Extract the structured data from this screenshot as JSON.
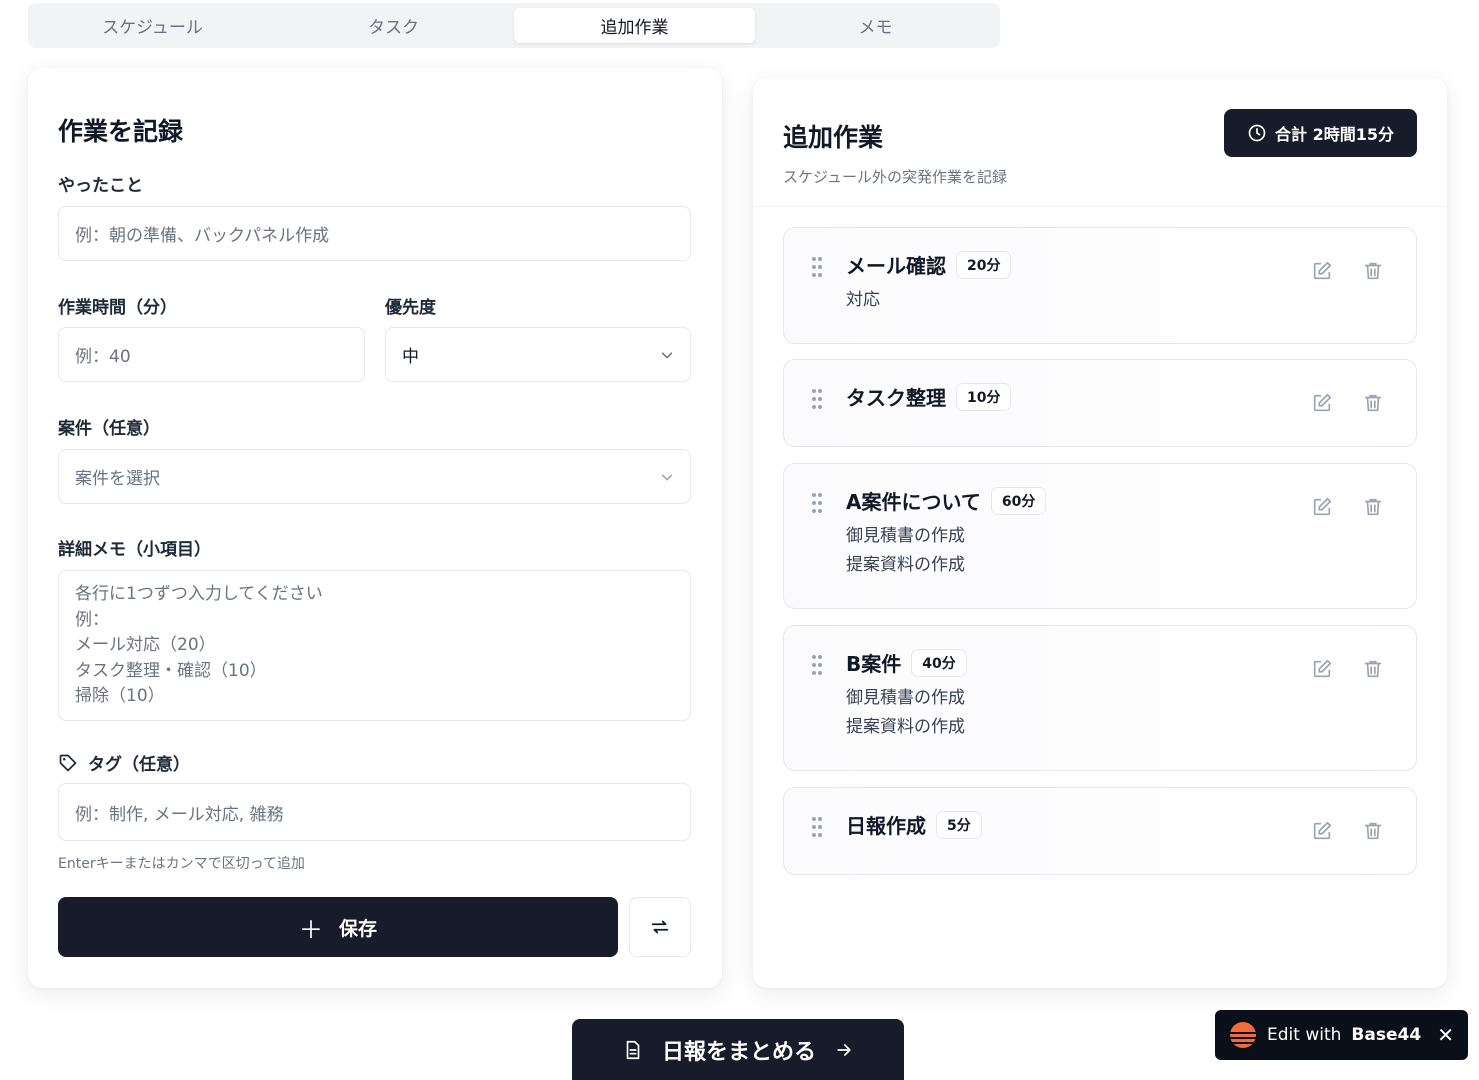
{
  "tabs": [
    {
      "label": "スケジュール"
    },
    {
      "label": "タスク"
    },
    {
      "label": "追加作業",
      "active": true
    },
    {
      "label": "メモ"
    }
  ],
  "form": {
    "title": "作業を記録",
    "what_label": "やったこと",
    "what_placeholder": "例：朝の準備、バックパネル作成",
    "time_label": "作業時間（分）",
    "time_placeholder": "例：40",
    "priority_label": "優先度",
    "priority_value": "中",
    "project_label": "案件（任意）",
    "project_placeholder": "案件を選択",
    "memo_label": "詳細メモ（小項目）",
    "memo_placeholder": "各行に1つずつ入力してください\n例：\nメール対応（20）\nタスク整理・確認（10）\n掃除（10）",
    "tag_label": "タグ（任意）",
    "tag_placeholder": "例：制作, メール対応, 雑務",
    "tag_hint": "Enterキーまたはカンマで区切って追加",
    "save_label": "保存"
  },
  "list": {
    "title": "追加作業",
    "subtitle": "スケジュール外の突発作業を記録",
    "total_label": "合計 2時間15分",
    "items": [
      {
        "title": "メール確認",
        "minutes": "20分",
        "lines": [
          "対応"
        ]
      },
      {
        "title": "タスク整理",
        "minutes": "10分",
        "lines": []
      },
      {
        "title": "A案件について",
        "minutes": "60分",
        "lines": [
          "御見積書の作成",
          "提案資料の作成"
        ]
      },
      {
        "title": "B案件",
        "minutes": "40分",
        "lines": [
          "御見積書の作成",
          "提案資料の作成"
        ]
      },
      {
        "title": "日報作成",
        "minutes": "5分",
        "lines": []
      }
    ]
  },
  "footer": {
    "summary_label": "日報をまとめる",
    "edit_with": "Edit with",
    "brand": "Base44"
  },
  "colors": {
    "primary": "#171b2a",
    "border": "#e5e7eb",
    "muted": "#6b7280",
    "brand_orange": "#f26b3a"
  }
}
